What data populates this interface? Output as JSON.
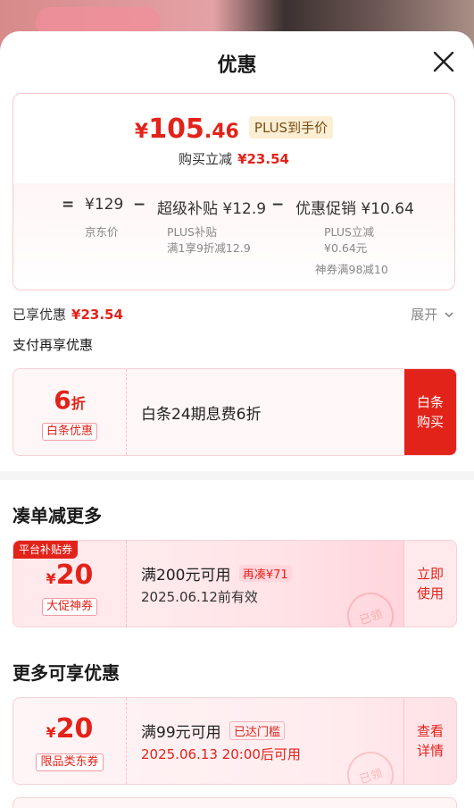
{
  "sheet_title": "优惠",
  "summary": {
    "currency": "¥",
    "price_int": "105",
    "price_dec": ".46",
    "plus_tag": "PLUS到手价",
    "instant_label": "购买立减",
    "instant_amount": "¥23.54",
    "equals": "=",
    "minus": "−",
    "jd_price": "¥129",
    "jd_price_label": "京东价",
    "subsidy": "超级补贴 ¥12.9",
    "subsidy_note1": "PLUS补贴",
    "subsidy_note2": "满1享9折减12.9",
    "promo": "优惠促销 ¥10.64",
    "promo_note1": "PLUS立减",
    "promo_note2": "¥0.64元",
    "promo_note3": "神券满98减10"
  },
  "enjoyed": {
    "label": "已享优惠",
    "amount": "¥23.54",
    "expand": "展开"
  },
  "pay_section": {
    "title": "支付再享优惠",
    "card": {
      "discount_num": "6",
      "discount_unit": "折",
      "tag": "白条优惠",
      "desc": "白条24期息费6折",
      "action": "白条购买",
      "action_line1": "白条",
      "action_line2": "购买"
    }
  },
  "more_orders": {
    "title": "凑单减更多",
    "coupon": {
      "platform_tag": "平台补贴券",
      "currency": "¥",
      "amount": "20",
      "tag": "大促神券",
      "condition": "满200元可用",
      "extra_tag": "再凑¥71",
      "expiry": "2025.06.12前有效",
      "action_line1": "立即",
      "action_line2": "使用",
      "stamp": "已领"
    }
  },
  "more_benefits": {
    "title": "更多可享优惠",
    "coupon": {
      "currency": "¥",
      "amount": "20",
      "tag": "限品类东券",
      "condition": "满99元可用",
      "extra_tag": "已达门槛",
      "expiry": "2025.06.13 20:00后可用",
      "action_line1": "查看",
      "action_line2": "详情",
      "stamp": "已领"
    }
  },
  "colors": {
    "accent": "#e2231a",
    "plus_tag_bg": "#fbeed4",
    "card_bg": "#fff7f7"
  },
  "icons": {
    "close": "close-icon",
    "expand": "chevron-down-icon"
  }
}
